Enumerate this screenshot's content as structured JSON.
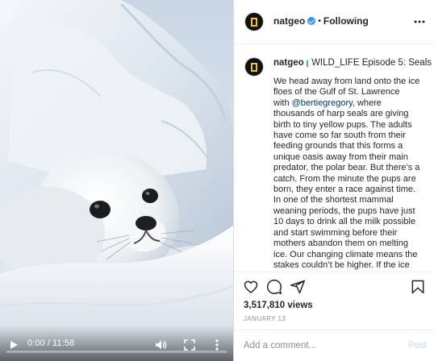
{
  "video": {
    "current_time": "0:00",
    "separator": "/",
    "duration": "11:58",
    "progress_fraction": 0.0
  },
  "header": {
    "username": "natgeo",
    "bullet": "•",
    "follow_status": "Following"
  },
  "caption": {
    "username": "natgeo",
    "title": "WILD_LIFE Episode 5: Seals",
    "lines": [
      "We head away from land onto the ice",
      "floes of the Gulf of St. Lawrence",
      "thousands of harp seals are giving",
      "birth to tiny yellow pups. The adults",
      "have come so far south from their",
      "feeding grounds that this forms a",
      "unique oasis away from their main",
      "predator, the polar bear. But there’s a",
      "catch. From the minute the pups are",
      "born, they enter a race against time.",
      "In one of the shortest mammal",
      "weaning periods, the pups have just",
      "10 days to drink all the milk possible",
      "and start swimming before their",
      "mothers abandon them on melting",
      "ice. Our changing climate means the",
      "stakes couldn’t be higher. If the ice"
    ],
    "line3_prefix": "with ",
    "mention": "@bertiegregory",
    "line3_suffix": ", where"
  },
  "stats": {
    "views": "3,517,810 views",
    "date": "JANUARY 13"
  },
  "comment": {
    "placeholder": "Add a comment...",
    "post_label": "Post"
  },
  "icons": {
    "play": "play-icon",
    "volume": "volume-icon",
    "fullscreen": "fullscreen-icon",
    "more_vertical": "more-vertical-icon",
    "more_horizontal": "more-horizontal-icon",
    "heart": "heart-icon",
    "comment": "comment-icon",
    "share": "share-icon",
    "bookmark": "bookmark-icon"
  },
  "colors": {
    "verified": "#3897f0",
    "logo_yellow": "#f5c518",
    "mention": "#00376b",
    "post_disabled": "#b2dffc"
  }
}
